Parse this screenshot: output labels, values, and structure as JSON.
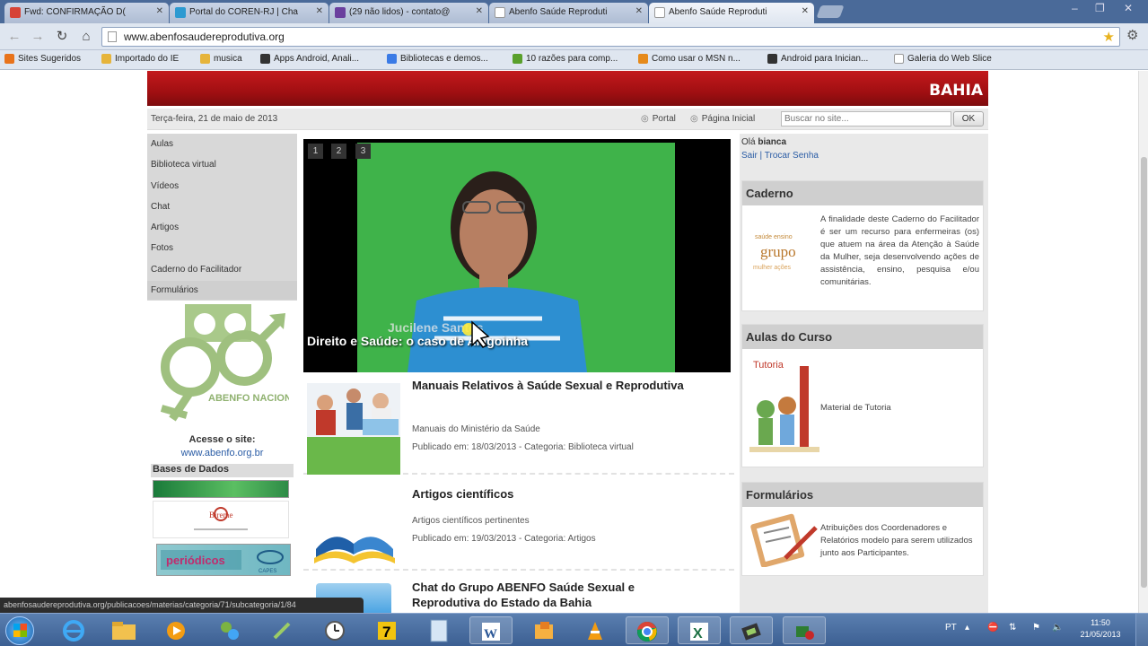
{
  "browser": {
    "tabs": [
      {
        "label": "Fwd: CONFIRMAÇÃO D(",
        "favicon_color": "#d64336"
      },
      {
        "label": "Portal do COREN-RJ | Cha",
        "favicon_color": "#2c9ad1"
      },
      {
        "label": "(29 não lidos) - contato@",
        "favicon_color": "#6a3f9e"
      },
      {
        "label": "Abenfo Saúde Reproduti",
        "favicon_color": "#ffffff"
      },
      {
        "label": "Abenfo Saúde Reproduti",
        "favicon_color": "#ffffff"
      }
    ],
    "active_tab": 4,
    "url": "www.abenfosaudereprodutiva.org",
    "bookmarks": [
      {
        "label": "Sites Sugeridos",
        "icon_color": "#e8731b"
      },
      {
        "label": "Importado do IE",
        "icon_color": "#e6b43b"
      },
      {
        "label": "musica",
        "icon_color": "#e6b43b"
      },
      {
        "label": "Apps Android, Anali...",
        "icon_color": "#333333"
      },
      {
        "label": "Bibliotecas e demos...",
        "icon_color": "#3b7be6"
      },
      {
        "label": "10 razões para comp...",
        "icon_color": "#5aa02c"
      },
      {
        "label": "Como usar o MSN n...",
        "icon_color": "#e68a1b"
      },
      {
        "label": "Android para Inician...",
        "icon_color": "#333333"
      },
      {
        "label": "Galeria do Web Slice",
        "icon_color": "#ffffff"
      }
    ]
  },
  "site": {
    "banner_state": "BAHIA",
    "date": "Terça-feira, 21 de maio de 2013",
    "top_links": [
      "Portal",
      "Página Inicial"
    ],
    "search_placeholder": "Buscar no site...",
    "search_button": "OK",
    "nav": [
      "Aulas",
      "Biblioteca virtual",
      "Vídeos",
      "Chat",
      "Artigos",
      "Fotos",
      "Caderno do Facilitador",
      "Formulários"
    ],
    "logo_text": "ABENFO NACIONAL",
    "acesse_label": "Acesse o site:",
    "acesse_link": "www.abenfo.org.br",
    "bases_label": "Bases de Dados",
    "db_logo_bireme": "Bireme",
    "db_logo_periodicos": "periódicos",
    "db_logo_capes": "CAPES",
    "video": {
      "pages": [
        "1",
        "2",
        "3"
      ],
      "caption": "Direito e Saúde: o caso de Alagoinha",
      "overlay_name": "Jucilene Santos"
    },
    "articles": [
      {
        "title": "Manuais Relativos à Saúde Sexual e Reprodutiva",
        "desc": "Manuais do Ministério da Saúde",
        "meta": "Publicado em: 18/03/2013 - Categoria: Biblioteca virtual"
      },
      {
        "title": "Artigos científicos",
        "desc": "Artigos científicos pertinentes",
        "meta": "Publicado em: 19/03/2013 - Categoria: Artigos"
      },
      {
        "title": "Chat do Grupo ABENFO Saúde Sexual e Reprodutiva do Estado da Bahia",
        "desc": "",
        "meta": ""
      }
    ],
    "user_greeting_prefix": "Olá",
    "user_name": "bianca",
    "user_links": "Sair | Trocar Senha",
    "boxes": [
      {
        "header": "Caderno",
        "text": "A finalidade deste Caderno do Facilitador é ser um recurso para enfermeiras (os) que atuem na área da Atenção à Saúde da Mulher, seja desenvolvendo ações de assistência, ensino, pesquisa e/ou comunitárias.",
        "pic_word": "grupo"
      },
      {
        "header": "Aulas do Curso",
        "text": "Material de Tutoria",
        "pic_word": "Tutoria"
      },
      {
        "header": "Formulários",
        "text": "Atribuições dos Coordenadores e Relatórios modelo para serem utilizados junto aos Participantes."
      }
    ]
  },
  "status_url": "abenfosaudereprodutiva.org/publicacoes/materias/categoria/71/subcategoria/1/84",
  "taskbar": {
    "lang": "PT",
    "time": "11:50",
    "date": "21/05/2013"
  }
}
